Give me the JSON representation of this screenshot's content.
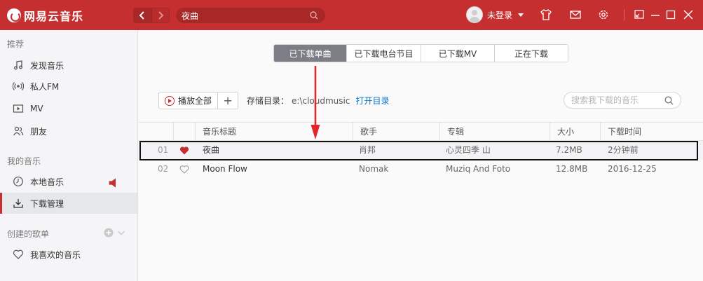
{
  "app": {
    "brand": "网易云音乐"
  },
  "titlebar": {
    "search_value": "夜曲",
    "user_name": "未登录"
  },
  "sidebar": {
    "section_recommend": "推荐",
    "items_recommend": [
      {
        "label": "发现音乐",
        "icon": "music-note-icon"
      },
      {
        "label": "私人FM",
        "icon": "radio-icon"
      },
      {
        "label": "MV",
        "icon": "video-icon"
      },
      {
        "label": "朋友",
        "icon": "friends-icon"
      }
    ],
    "section_my_music": "我的音乐",
    "items_my_music": [
      {
        "label": "本地音乐",
        "icon": "clock-icon"
      },
      {
        "label": "下载管理",
        "icon": "download-icon"
      }
    ],
    "section_playlists": "创建的歌单",
    "items_playlists": [
      {
        "label": "我喜欢的音乐",
        "icon": "heart-icon"
      }
    ]
  },
  "tabs": [
    {
      "label": "已下载单曲",
      "active": true
    },
    {
      "label": "已下载电台节目",
      "active": false
    },
    {
      "label": "已下载MV",
      "active": false
    },
    {
      "label": "正在下载",
      "active": false
    }
  ],
  "toolbar": {
    "play_all": "播放全部",
    "add": "+",
    "storage_label": "存储目录：",
    "storage_path": "e:\\cloudmusic",
    "open_dir": "打开目录"
  },
  "local_search": {
    "placeholder": "搜索我下载的音乐"
  },
  "table": {
    "headers": [
      "音乐标题",
      "歌手",
      "专辑",
      "大小",
      "下载时间"
    ],
    "rows": [
      {
        "index": "01",
        "liked": true,
        "title": "夜曲",
        "artist": "肖邦",
        "album": "心灵四季 山",
        "size": "7.2MB",
        "time": "2分钟前"
      },
      {
        "index": "02",
        "liked": false,
        "title": "Moon Flow",
        "artist": "Nomak",
        "album": "Muziq And Foto",
        "size": "12.8MB",
        "time": "2016-12-25"
      }
    ]
  },
  "colors": {
    "brand_red": "#c62f2f",
    "active_tab": "#7c7d85",
    "link_blue": "#0c73c2",
    "annotation_arrow": "#e0262b"
  }
}
